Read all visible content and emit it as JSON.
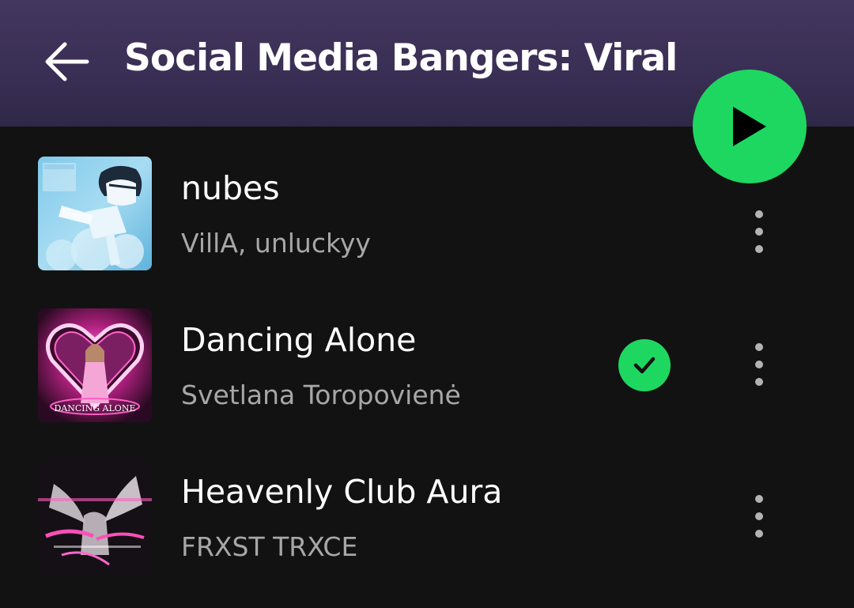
{
  "header": {
    "title": "Social Media Bangers: Viral",
    "back_icon": "arrow-left-icon"
  },
  "play_button": {
    "icon": "play-icon",
    "color": "#1ed760"
  },
  "tracks": [
    {
      "title": "nubes",
      "artist": "VillA, unluckyy",
      "downloaded": false,
      "art_icon": "album-art-anime-boy"
    },
    {
      "title": "Dancing Alone",
      "artist": "Svetlana Toropovienė",
      "downloaded": true,
      "art_icon": "album-art-neon-heart",
      "art_text": "DANCING ALONE"
    },
    {
      "title": "Heavenly Club Aura",
      "artist": "FRXST TRXCE",
      "downloaded": false,
      "art_icon": "album-art-glitch-angel"
    }
  ],
  "colors": {
    "background": "#121212",
    "header": "#3a2f55",
    "accent": "#1ed760",
    "secondary_text": "#a7a7a7"
  }
}
